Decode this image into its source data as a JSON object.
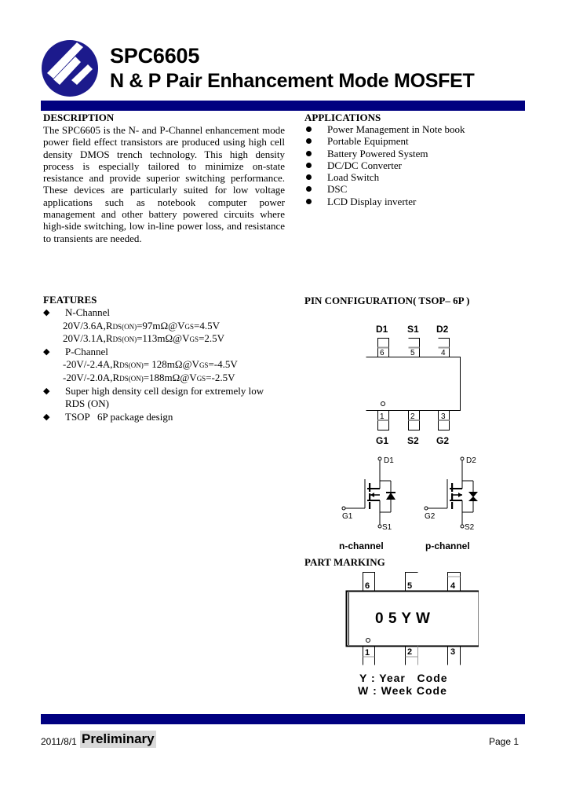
{
  "header": {
    "part_number": "SPC6605",
    "subtitle": "N & P Pair Enhancement Mode MOSFET",
    "brand_color": "#000080"
  },
  "description": {
    "heading": "DESCRIPTION",
    "text": "The SPC6605 is the N- and P-Channel enhancement mode power field effect transistors are produced using high cell density DMOS trench technology. This high density process is especially tailored to minimize on-state resistance and provide superior switching performance. These devices are particularly suited for low voltage applications such as notebook computer power management and other battery powered circuits where high-side switching, low in-line power loss, and resistance to transients are needed."
  },
  "applications": {
    "heading": "APPLICATIONS",
    "items": [
      "Power Management in Note book",
      "Portable Equipment",
      "Battery Powered System",
      "DC/DC Converter",
      "Load Switch",
      "DSC",
      "LCD Display inverter"
    ]
  },
  "features": {
    "heading": "FEATURES",
    "n_channel": {
      "label": "N-Channel",
      "lines": [
        {
          "pre": "20V/3.6A,R",
          "sub": "DS(ON)",
          "mid": "=97mΩ@V",
          "sub2": "GS",
          "post": "=4.5V"
        },
        {
          "pre": "20V/3.1A,R",
          "sub": "DS(ON)",
          "mid": "=113mΩ@V",
          "sub2": "GS",
          "post": "=2.5V"
        }
      ]
    },
    "p_channel": {
      "label": "P-Channel",
      "lines": [
        {
          "pre": "-20V/-2.4A,R",
          "sub": "DS(ON)",
          "mid": "= 128mΩ@V",
          "sub2": "GS",
          "post": "=-4.5V"
        },
        {
          "pre": "-20V/-2.0A,R",
          "sub": "DS(ON)",
          "mid": "=188mΩ@V",
          "sub2": "GS",
          "post": "=-2.5V"
        }
      ]
    },
    "density": {
      "line1": "Super high density cell design for extremely low",
      "line2": "RDS (ON)"
    },
    "package": "TSOP   6P package design"
  },
  "pin_config": {
    "heading": "PIN CONFIGURATION( TSOP– 6P )",
    "top_labels": [
      "D1",
      "S1",
      "D2"
    ],
    "top_numbers": [
      "6",
      "5",
      "4"
    ],
    "bottom_numbers": [
      "1",
      "2",
      "3"
    ],
    "bottom_labels": [
      "G1",
      "S2",
      "G2"
    ]
  },
  "schematics": {
    "n": {
      "drain": "D1",
      "gate": "G1",
      "source": "S1",
      "caption": "n-channel"
    },
    "p": {
      "drain": "D2",
      "gate": "G2",
      "source": "S2",
      "caption": "p-channel"
    }
  },
  "part_marking": {
    "heading": "PART MARKING",
    "marking": "0 5 Y W",
    "top_numbers": [
      "6",
      "5",
      "4"
    ],
    "bottom_numbers": [
      "1",
      "2",
      "3"
    ],
    "legend": [
      "Y : Year   Code",
      "W : Week Code"
    ]
  },
  "footer": {
    "date": "2011/8/1",
    "status": "Preliminary",
    "page": "Page 1"
  }
}
